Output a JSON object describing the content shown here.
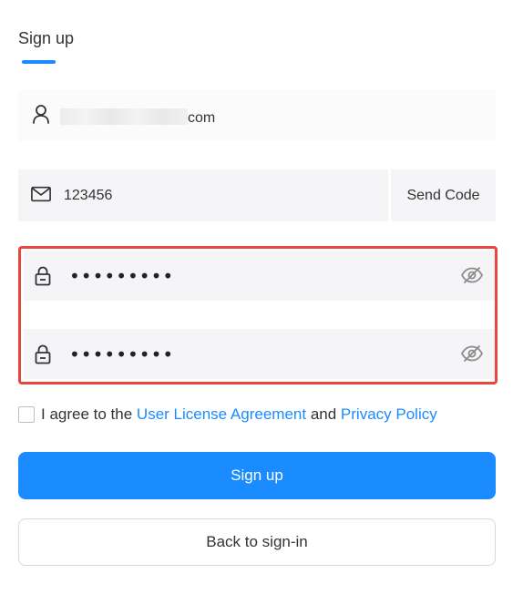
{
  "header": {
    "tab_label": "Sign up",
    "accent_color": "#1a8cff"
  },
  "email": {
    "value_suffix": "com",
    "icon": "user-icon"
  },
  "code": {
    "value": "123456",
    "icon": "mail-icon",
    "send_label": "Send Code"
  },
  "password": {
    "value": "•••••••••",
    "icon": "lock-icon",
    "toggle_icon": "eye-hidden-icon"
  },
  "confirm_password": {
    "value": "•••••••••",
    "icon": "lock-icon",
    "toggle_icon": "eye-hidden-icon"
  },
  "highlight_color": "#e8473f",
  "agreement": {
    "prefix": "I agree to the",
    "license_link": "User License Agreement",
    "conjunction": "and",
    "privacy_link": "Privacy Policy"
  },
  "actions": {
    "signup_label": "Sign up",
    "back_label": "Back to sign-in"
  }
}
